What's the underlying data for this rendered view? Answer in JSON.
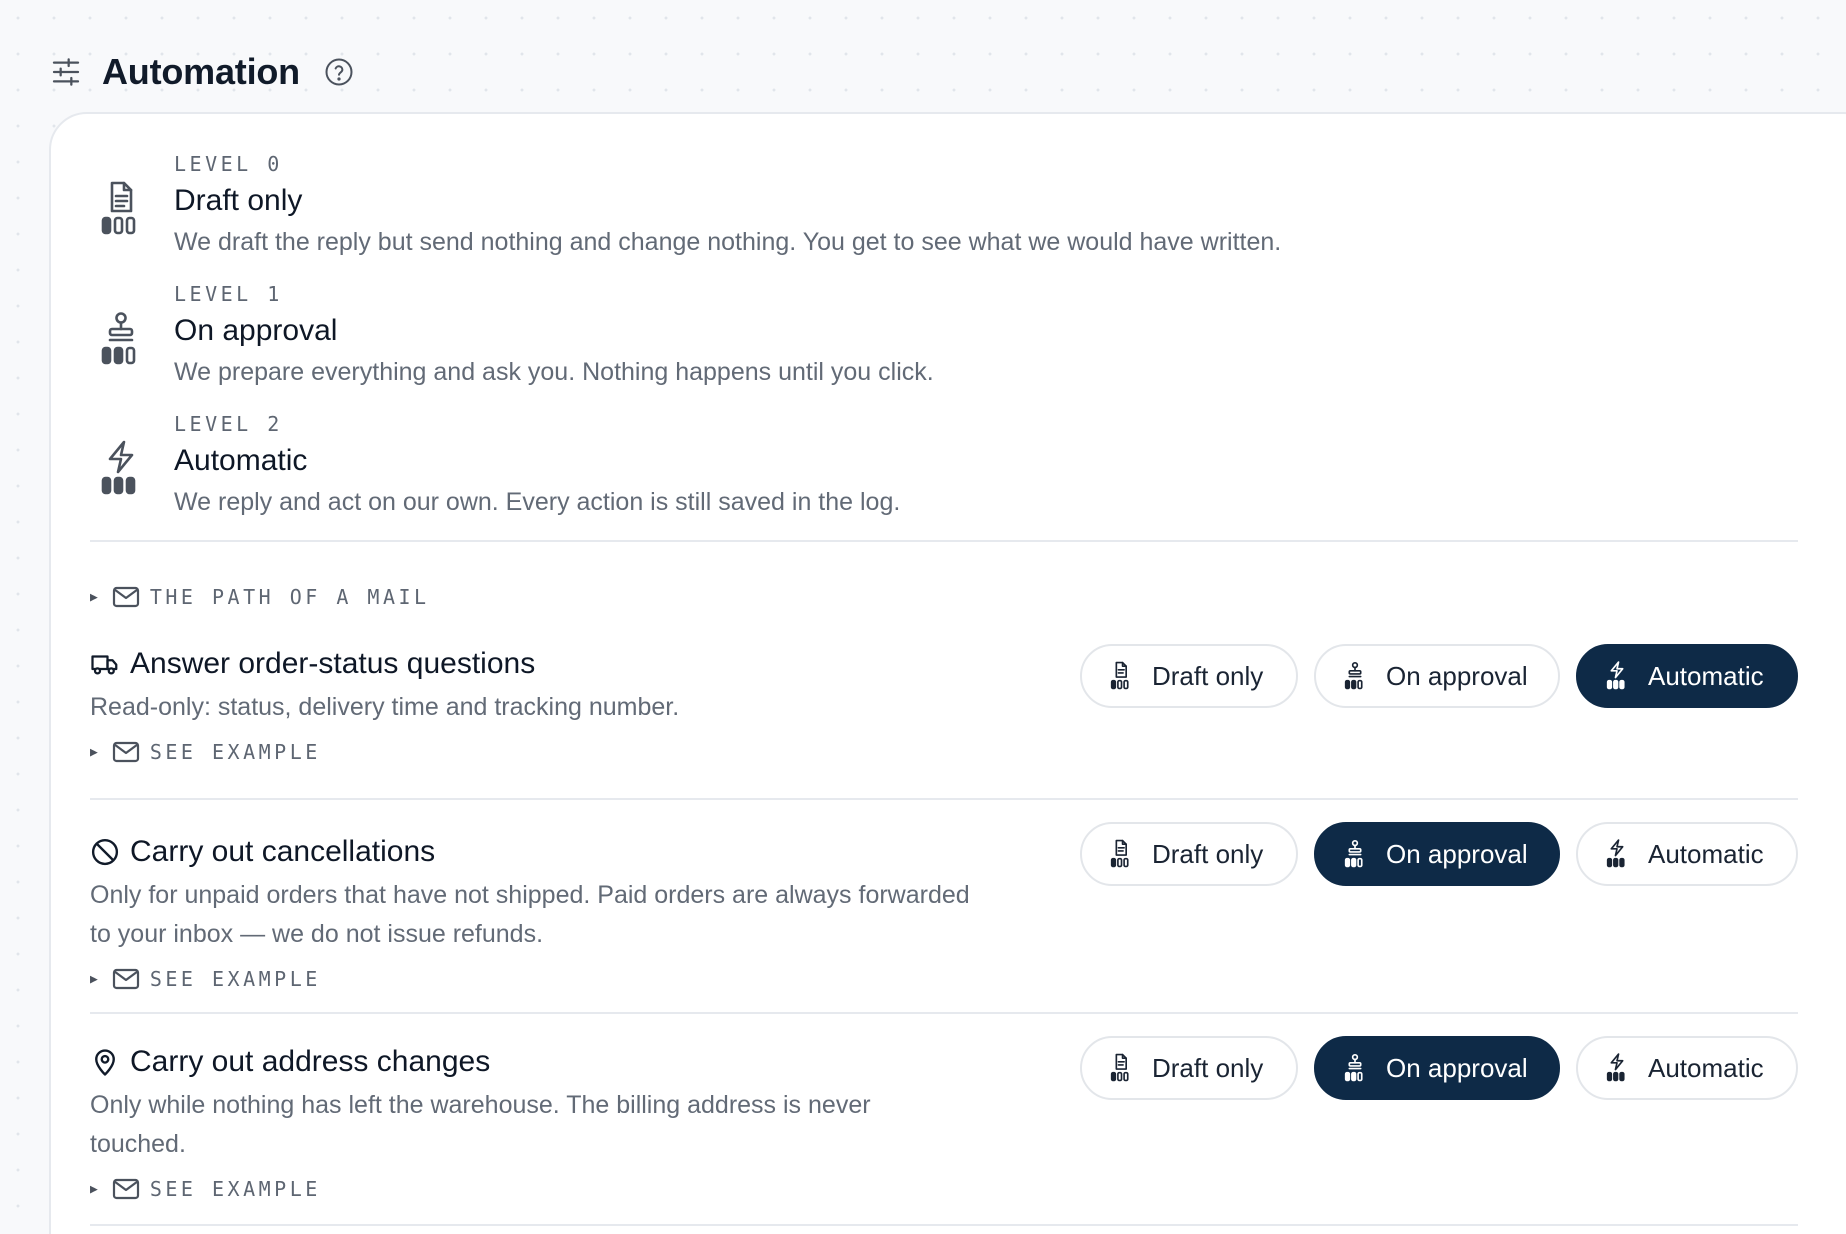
{
  "header": {
    "title": "Automation",
    "icon": "tune-icon",
    "help_icon": "help-circle-icon"
  },
  "levels": [
    {
      "tag": "LEVEL 0",
      "name": "Draft only",
      "description": "We draft the reply but send nothing and change nothing. You get to see what we would have written.",
      "icon": "document-icon"
    },
    {
      "tag": "LEVEL 1",
      "name": "On approval",
      "description": "We prepare everything and ask you. Nothing happens until you click.",
      "icon": "stamp-icon"
    },
    {
      "tag": "LEVEL 2",
      "name": "Automatic",
      "description": "We reply and act on our own. Every action is still saved in the log.",
      "icon": "lightning-icon"
    }
  ],
  "path_of_mail": {
    "label": "THE PATH OF A MAIL",
    "icon": "mail-icon"
  },
  "options": {
    "draft": "Draft only",
    "approval": "On approval",
    "automatic": "Automatic"
  },
  "tasks": [
    {
      "title": "Answer order-status questions",
      "description": "Read-only: status, delivery time and tracking number.",
      "example_label": "SEE EXAMPLE",
      "selected": "automatic",
      "icon": "truck-icon"
    },
    {
      "title": "Carry out cancellations",
      "description": "Only for unpaid orders that have not shipped. Paid orders are always forwarded to your inbox — we do not issue refunds.",
      "example_label": "SEE EXAMPLE",
      "selected": "approval",
      "icon": "ban-icon"
    },
    {
      "title": "Carry out address changes",
      "description": "Only while nothing has left the warehouse. The billing address is never touched.",
      "example_label": "SEE EXAMPLE",
      "selected": "approval",
      "icon": "map-pin-icon"
    }
  ],
  "colors": {
    "selected": "#0e2a47",
    "muted_text": "#626a76",
    "border": "#e3e6ea"
  }
}
